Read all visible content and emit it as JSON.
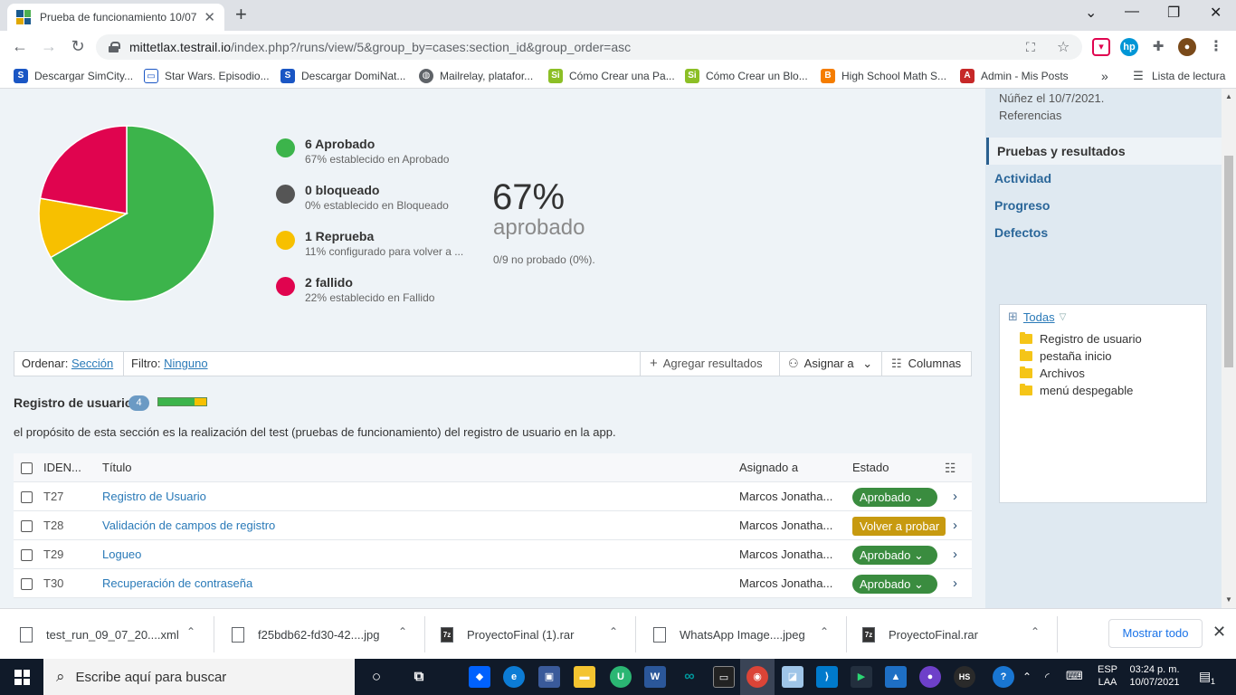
{
  "browser": {
    "tab_title": "Prueba de funcionamiento 10/07",
    "url_host": "mittetlax.testrail.io",
    "url_rest": "/index.php?/runs/view/5&group_by=cases:section_id&group_order=asc",
    "bookmarks": [
      "Descargar SimCity...",
      "Star Wars. Episodio...",
      "Descargar DomiNat...",
      "Mailrelay, platafor...",
      "Cómo Crear una Pa...",
      "Cómo Crear un Blo...",
      "High School Math S...",
      "Admin - Mis Posts"
    ],
    "reading_list": "Lista de lectura",
    "more": "»"
  },
  "chart_data": {
    "type": "pie",
    "categories": [
      "Aprobado",
      "Reprueba",
      "Fallido",
      "Bloqueado"
    ],
    "values": [
      6,
      1,
      2,
      0
    ],
    "colors": [
      "#3cb44b",
      "#f7c000",
      "#e0044f",
      "#555555"
    ]
  },
  "legend": [
    {
      "title": "6 Aprobado",
      "sub": "67% establecido en Aprobado",
      "color": "#3cb44b"
    },
    {
      "title": "0 bloqueado",
      "sub": "0% establecido en Bloqueado",
      "color": "#555555"
    },
    {
      "title": "1 Reprueba",
      "sub": "11% configurado para volver a ...",
      "color": "#f7c000"
    },
    {
      "title": "2 fallido",
      "sub": "22% establecido en Fallido",
      "color": "#e0044f"
    }
  ],
  "summary": {
    "percent": "67%",
    "label": "aprobado",
    "untested": "0/9 no probado (0%)."
  },
  "filterbar": {
    "sort_label": "Ordenar:",
    "sort_value": "Sección",
    "filter_label": "Filtro:",
    "filter_value": "Ninguno",
    "add_results": "Agregar resultados",
    "assign": "Asignar a",
    "columns": "Columnas"
  },
  "section": {
    "title": "Registro de usuario",
    "count": "4",
    "progress": {
      "passed": 0.75,
      "retest": 0.25
    },
    "description": "el propósito de esta sección es la realización del test (pruebas de funcionamiento) del registro de usuario en la app."
  },
  "table": {
    "headers": {
      "id": "IDEN...",
      "title": "Título",
      "assigned": "Asignado a",
      "status": "Estado"
    },
    "rows": [
      {
        "id": "T27",
        "title": "Registro de Usuario",
        "assigned": "Marcos Jonatha...",
        "status": "Aprobado",
        "kind": "ok"
      },
      {
        "id": "T28",
        "title": "Validación de campos de registro",
        "assigned": "Marcos Jonatha...",
        "status": "Volver a probar",
        "kind": "retest"
      },
      {
        "id": "T29",
        "title": "Logueo",
        "assigned": "Marcos Jonatha...",
        "status": "Aprobado",
        "kind": "ok"
      },
      {
        "id": "T30",
        "title": "Recuperación de contraseña",
        "assigned": "Marcos Jonatha...",
        "status": "Aprobado",
        "kind": "ok"
      }
    ]
  },
  "sidebar": {
    "meta_line1": "Núñez el 10/7/2021.",
    "meta_line2": "Referencias",
    "active": "Pruebas y resultados",
    "links": [
      "Actividad",
      "Progreso",
      "Defectos"
    ],
    "tree_header": "Todas",
    "tree_items": [
      "Registro de usuario",
      "pestaña inicio",
      "Archivos",
      "menú despegable"
    ]
  },
  "downloads": {
    "items": [
      "test_run_09_07_20....xml",
      "f25bdb62-fd30-42....jpg",
      "ProyectoFinal (1).rar",
      "WhatsApp Image....jpeg",
      "ProyectoFinal.rar"
    ],
    "show_all": "Mostrar todo"
  },
  "taskbar": {
    "search_placeholder": "Escribe aquí para buscar",
    "lang_line1": "ESP",
    "lang_line2": "LAA",
    "time": "03:24 p. m.",
    "date": "10/07/2021",
    "notif_count": "1"
  }
}
